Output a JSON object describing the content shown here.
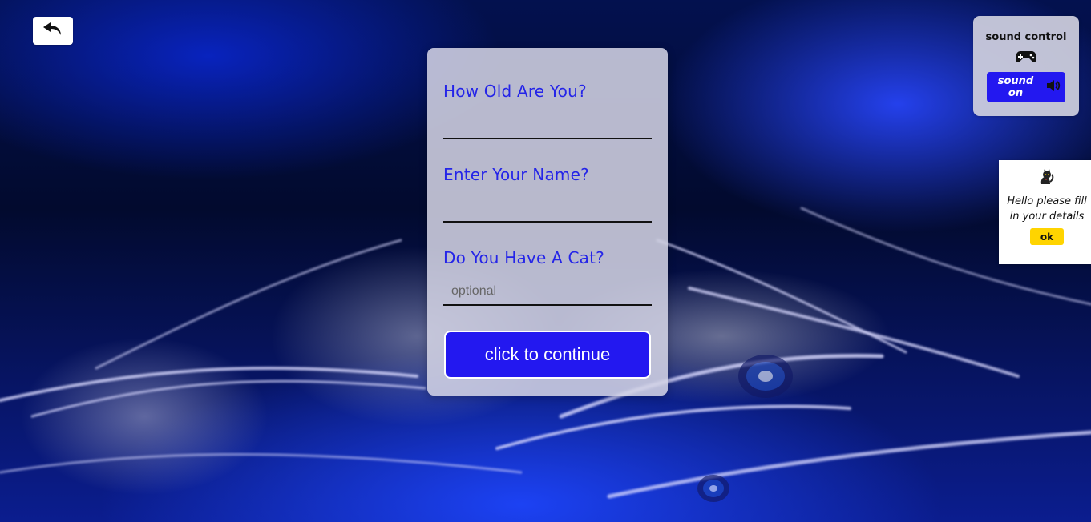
{
  "navigation": {
    "back_icon": "undo-arrow-icon"
  },
  "form": {
    "age_label": "How Old Are You?",
    "age_value": "",
    "name_label": "Enter Your Name?",
    "name_value": "",
    "cat_label": "Do You Have A Cat?",
    "cat_placeholder": "optional",
    "cat_value": "",
    "continue_label": "click to continue"
  },
  "sound_control": {
    "title": "sound control",
    "status_label": "sound on",
    "gamepad_icon": "gamepad-icon",
    "speaker_icon": "speaker-icon"
  },
  "message": {
    "cat_icon": "cat-icon",
    "text": "Hello please fill in your details",
    "button_label": "ok"
  },
  "colors": {
    "primary_button": "#2318f0",
    "label_text": "#2424e8",
    "ok_button": "#ffd400"
  }
}
